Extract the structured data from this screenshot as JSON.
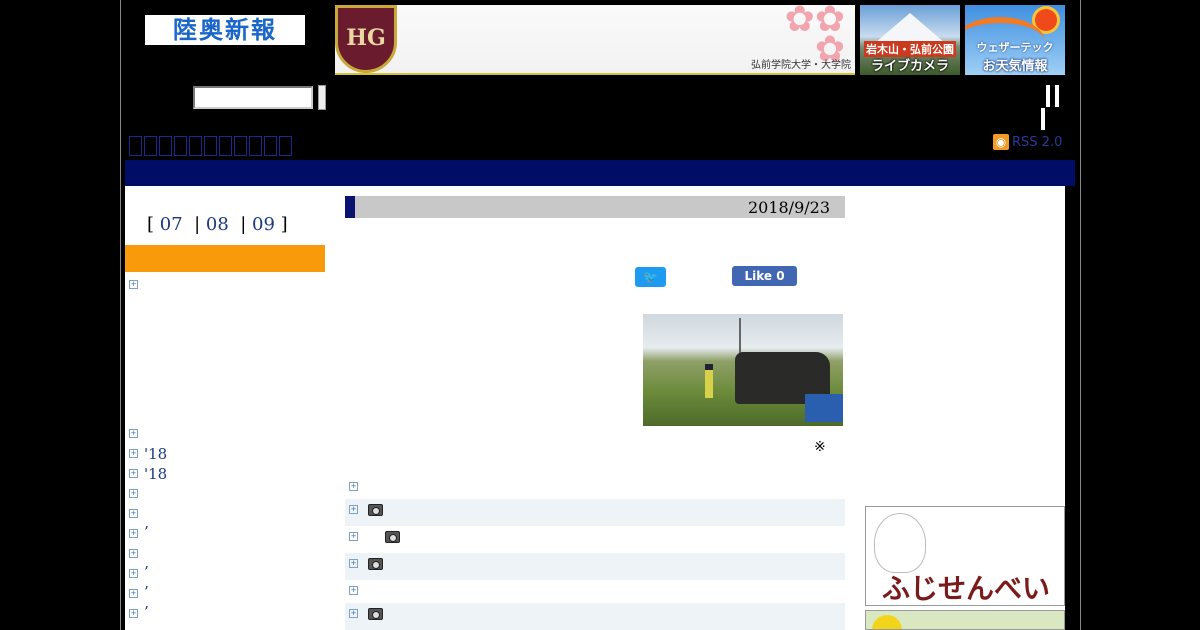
{
  "header": {
    "logo_text": "陸奥新報",
    "banners": [
      {
        "name": "hirosaki-gakuin-univ",
        "emblem": "HG",
        "caption": "弘前学院大学・大学院"
      },
      {
        "name": "iwaki-live-camera",
        "line1": "岩木山・弘前公園",
        "line2": "ライブカメラ"
      },
      {
        "name": "weathertech",
        "line1": "ウェザーテック",
        "line2": "お天気情報"
      }
    ],
    "search": {
      "value": "",
      "placeholder": ""
    },
    "rss_label": "RSS 2.0"
  },
  "sidebar": {
    "months": [
      "07",
      "08",
      "09"
    ],
    "items": [
      {
        "text": ""
      },
      {
        "text": ""
      },
      {
        "text": "'18"
      },
      {
        "text": "'18"
      },
      {
        "text": ""
      },
      {
        "text": ""
      },
      {
        "text": "’"
      },
      {
        "text": ""
      },
      {
        "text": "’"
      },
      {
        "text": "’"
      },
      {
        "text": "’"
      }
    ]
  },
  "article": {
    "date": "2018/9/23",
    "note_mark": "※",
    "buttons": {
      "tweet": "",
      "like": "Like 0"
    },
    "photo_alt": "accident-vehicle-photo"
  },
  "related_list": [
    {
      "camera": false,
      "indent": false,
      "shade": false
    },
    {
      "camera": true,
      "indent": false,
      "shade": true
    },
    {
      "camera": true,
      "indent": true,
      "shade": false
    },
    {
      "camera": true,
      "indent": false,
      "shade": true
    },
    {
      "camera": false,
      "indent": false,
      "shade": false
    },
    {
      "camera": true,
      "indent": false,
      "shade": true
    }
  ],
  "ads": {
    "senbei_title": "ふじせんべい"
  },
  "colors": {
    "navbar": "#000d66",
    "accent_orange": "#f99a0a",
    "date_bar": "#c8c8c8",
    "twitter": "#1d9bf0",
    "facebook": "#4267b2"
  }
}
